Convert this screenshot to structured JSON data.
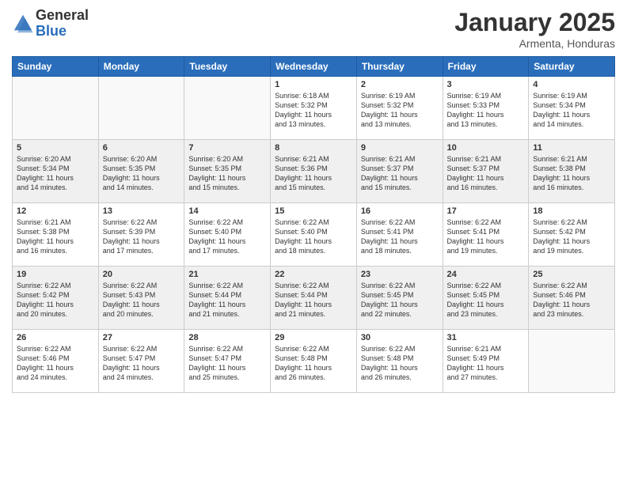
{
  "header": {
    "logo_general": "General",
    "logo_blue": "Blue",
    "title": "January 2025",
    "subtitle": "Armenta, Honduras"
  },
  "weekdays": [
    "Sunday",
    "Monday",
    "Tuesday",
    "Wednesday",
    "Thursday",
    "Friday",
    "Saturday"
  ],
  "weeks": [
    [
      {
        "day": "",
        "info": ""
      },
      {
        "day": "",
        "info": ""
      },
      {
        "day": "",
        "info": ""
      },
      {
        "day": "1",
        "info": "Sunrise: 6:18 AM\nSunset: 5:32 PM\nDaylight: 11 hours\nand 13 minutes."
      },
      {
        "day": "2",
        "info": "Sunrise: 6:19 AM\nSunset: 5:32 PM\nDaylight: 11 hours\nand 13 minutes."
      },
      {
        "day": "3",
        "info": "Sunrise: 6:19 AM\nSunset: 5:33 PM\nDaylight: 11 hours\nand 13 minutes."
      },
      {
        "day": "4",
        "info": "Sunrise: 6:19 AM\nSunset: 5:34 PM\nDaylight: 11 hours\nand 14 minutes."
      }
    ],
    [
      {
        "day": "5",
        "info": "Sunrise: 6:20 AM\nSunset: 5:34 PM\nDaylight: 11 hours\nand 14 minutes."
      },
      {
        "day": "6",
        "info": "Sunrise: 6:20 AM\nSunset: 5:35 PM\nDaylight: 11 hours\nand 14 minutes."
      },
      {
        "day": "7",
        "info": "Sunrise: 6:20 AM\nSunset: 5:35 PM\nDaylight: 11 hours\nand 15 minutes."
      },
      {
        "day": "8",
        "info": "Sunrise: 6:21 AM\nSunset: 5:36 PM\nDaylight: 11 hours\nand 15 minutes."
      },
      {
        "day": "9",
        "info": "Sunrise: 6:21 AM\nSunset: 5:37 PM\nDaylight: 11 hours\nand 15 minutes."
      },
      {
        "day": "10",
        "info": "Sunrise: 6:21 AM\nSunset: 5:37 PM\nDaylight: 11 hours\nand 16 minutes."
      },
      {
        "day": "11",
        "info": "Sunrise: 6:21 AM\nSunset: 5:38 PM\nDaylight: 11 hours\nand 16 minutes."
      }
    ],
    [
      {
        "day": "12",
        "info": "Sunrise: 6:21 AM\nSunset: 5:38 PM\nDaylight: 11 hours\nand 16 minutes."
      },
      {
        "day": "13",
        "info": "Sunrise: 6:22 AM\nSunset: 5:39 PM\nDaylight: 11 hours\nand 17 minutes."
      },
      {
        "day": "14",
        "info": "Sunrise: 6:22 AM\nSunset: 5:40 PM\nDaylight: 11 hours\nand 17 minutes."
      },
      {
        "day": "15",
        "info": "Sunrise: 6:22 AM\nSunset: 5:40 PM\nDaylight: 11 hours\nand 18 minutes."
      },
      {
        "day": "16",
        "info": "Sunrise: 6:22 AM\nSunset: 5:41 PM\nDaylight: 11 hours\nand 18 minutes."
      },
      {
        "day": "17",
        "info": "Sunrise: 6:22 AM\nSunset: 5:41 PM\nDaylight: 11 hours\nand 19 minutes."
      },
      {
        "day": "18",
        "info": "Sunrise: 6:22 AM\nSunset: 5:42 PM\nDaylight: 11 hours\nand 19 minutes."
      }
    ],
    [
      {
        "day": "19",
        "info": "Sunrise: 6:22 AM\nSunset: 5:42 PM\nDaylight: 11 hours\nand 20 minutes."
      },
      {
        "day": "20",
        "info": "Sunrise: 6:22 AM\nSunset: 5:43 PM\nDaylight: 11 hours\nand 20 minutes."
      },
      {
        "day": "21",
        "info": "Sunrise: 6:22 AM\nSunset: 5:44 PM\nDaylight: 11 hours\nand 21 minutes."
      },
      {
        "day": "22",
        "info": "Sunrise: 6:22 AM\nSunset: 5:44 PM\nDaylight: 11 hours\nand 21 minutes."
      },
      {
        "day": "23",
        "info": "Sunrise: 6:22 AM\nSunset: 5:45 PM\nDaylight: 11 hours\nand 22 minutes."
      },
      {
        "day": "24",
        "info": "Sunrise: 6:22 AM\nSunset: 5:45 PM\nDaylight: 11 hours\nand 23 minutes."
      },
      {
        "day": "25",
        "info": "Sunrise: 6:22 AM\nSunset: 5:46 PM\nDaylight: 11 hours\nand 23 minutes."
      }
    ],
    [
      {
        "day": "26",
        "info": "Sunrise: 6:22 AM\nSunset: 5:46 PM\nDaylight: 11 hours\nand 24 minutes."
      },
      {
        "day": "27",
        "info": "Sunrise: 6:22 AM\nSunset: 5:47 PM\nDaylight: 11 hours\nand 24 minutes."
      },
      {
        "day": "28",
        "info": "Sunrise: 6:22 AM\nSunset: 5:47 PM\nDaylight: 11 hours\nand 25 minutes."
      },
      {
        "day": "29",
        "info": "Sunrise: 6:22 AM\nSunset: 5:48 PM\nDaylight: 11 hours\nand 26 minutes."
      },
      {
        "day": "30",
        "info": "Sunrise: 6:22 AM\nSunset: 5:48 PM\nDaylight: 11 hours\nand 26 minutes."
      },
      {
        "day": "31",
        "info": "Sunrise: 6:21 AM\nSunset: 5:49 PM\nDaylight: 11 hours\nand 27 minutes."
      },
      {
        "day": "",
        "info": ""
      }
    ]
  ]
}
